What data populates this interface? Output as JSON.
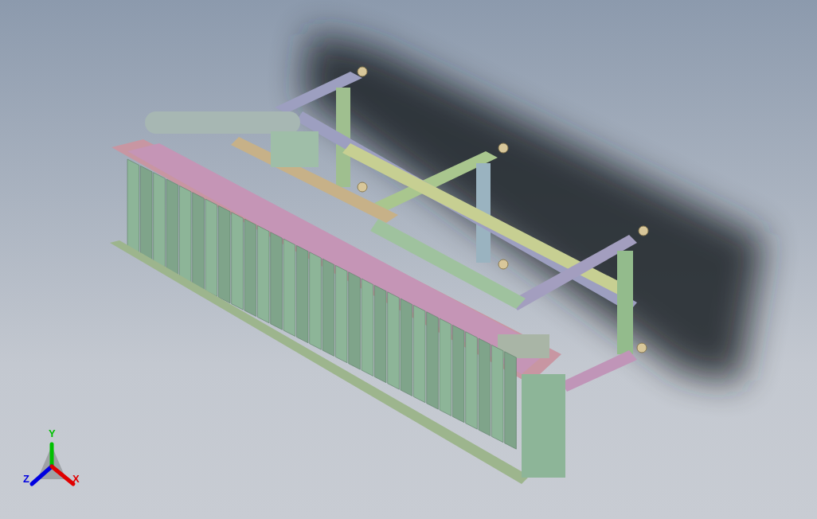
{
  "viewport": {
    "axes": [
      {
        "label": "Y",
        "color": "#00c000"
      },
      {
        "label": "Z",
        "color": "#0000e0"
      },
      {
        "label": "X",
        "color": "#e00000"
      }
    ]
  }
}
